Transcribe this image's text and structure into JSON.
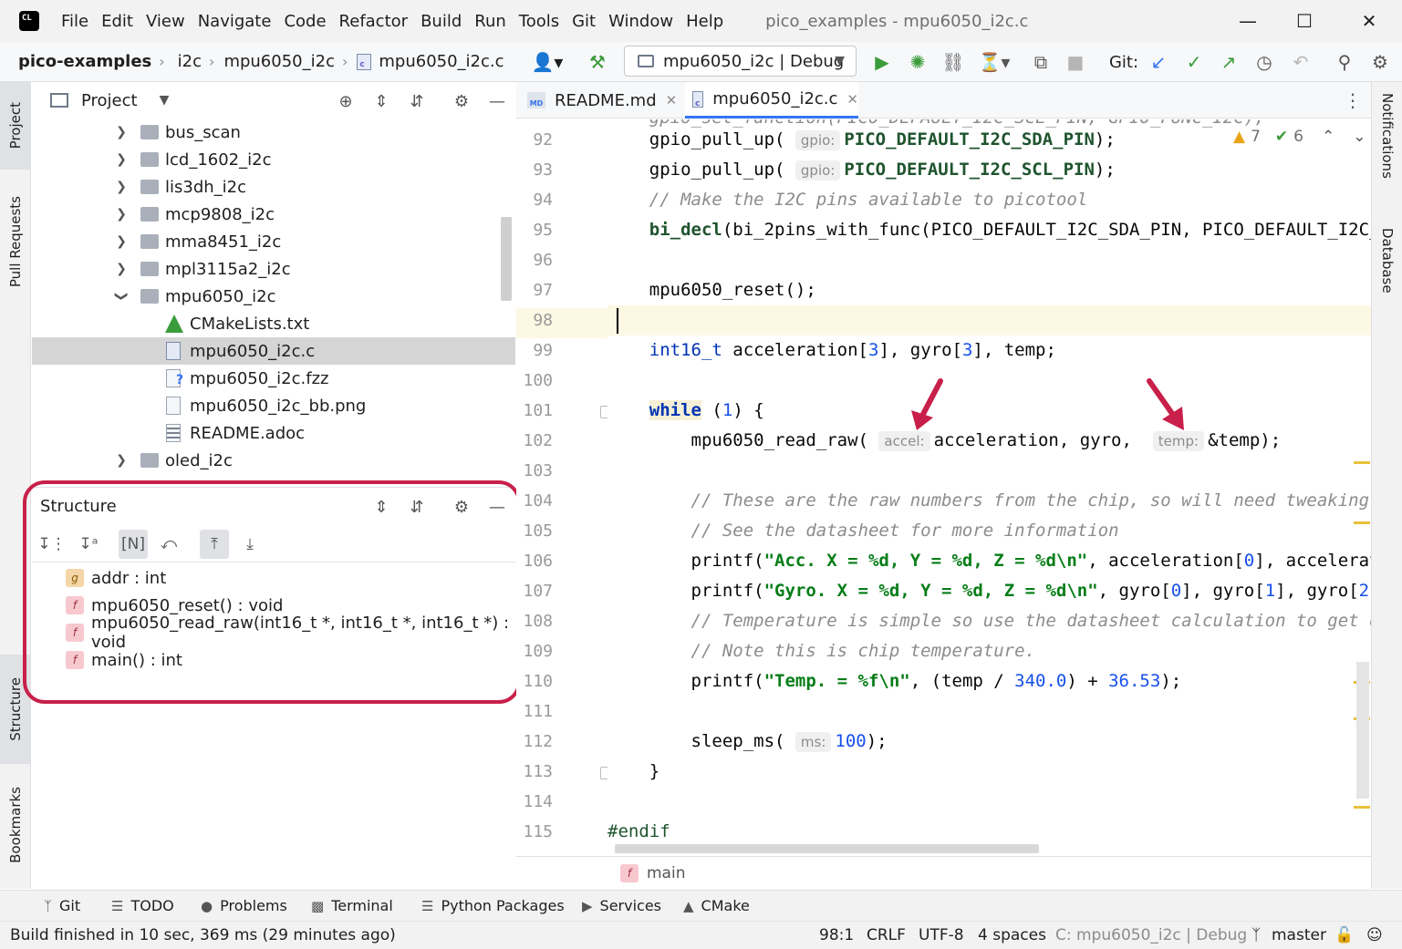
{
  "titlebar": {
    "logo_text": "CL",
    "menu": [
      "File",
      "Edit",
      "View",
      "Navigate",
      "Code",
      "Refactor",
      "Build",
      "Run",
      "Tools",
      "Git",
      "Window",
      "Help"
    ],
    "window_title": "pico_examples - mpu6050_i2c.c"
  },
  "navbar": {
    "breadcrumbs": [
      "pico-examples",
      "i2c",
      "mpu6050_i2c",
      "mpu6050_i2c.c"
    ],
    "run_config": "mpu6050_i2c | Debug",
    "git_label": "Git:"
  },
  "left_stripe": {
    "project": "Project",
    "pull_requests": "Pull Requests",
    "structure": "Structure",
    "bookmarks": "Bookmarks"
  },
  "right_stripe": {
    "notifications": "Notifications",
    "database": "Database"
  },
  "project_panel": {
    "title": "Project",
    "tree": [
      {
        "label": "bus_scan",
        "kind": "folder",
        "state": "collapsed"
      },
      {
        "label": "lcd_1602_i2c",
        "kind": "folder",
        "state": "collapsed"
      },
      {
        "label": "lis3dh_i2c",
        "kind": "folder",
        "state": "collapsed"
      },
      {
        "label": "mcp9808_i2c",
        "kind": "folder",
        "state": "collapsed"
      },
      {
        "label": "mma8451_i2c",
        "kind": "folder",
        "state": "collapsed"
      },
      {
        "label": "mpl3115a2_i2c",
        "kind": "folder",
        "state": "collapsed"
      },
      {
        "label": "mpu6050_i2c",
        "kind": "folder",
        "state": "expanded"
      },
      {
        "label": "CMakeLists.txt",
        "kind": "cmake"
      },
      {
        "label": "mpu6050_i2c.c",
        "kind": "c",
        "selected": true
      },
      {
        "label": "mpu6050_i2c.fzz",
        "kind": "unknown"
      },
      {
        "label": "mpu6050_i2c_bb.png",
        "kind": "image"
      },
      {
        "label": "README.adoc",
        "kind": "text"
      },
      {
        "label": "oled_i2c",
        "kind": "folder",
        "state": "collapsed"
      }
    ]
  },
  "structure_panel": {
    "title": "Structure",
    "members": [
      {
        "icon": "g",
        "kind": "var",
        "label": "addr : int"
      },
      {
        "icon": "f",
        "kind": "fn",
        "label": "mpu6050_reset() : void"
      },
      {
        "icon": "f",
        "kind": "fn",
        "label": "mpu6050_read_raw(int16_t *, int16_t *, int16_t *) : void"
      },
      {
        "icon": "f",
        "kind": "fn",
        "label": "main() : int"
      }
    ]
  },
  "editor": {
    "tabs": [
      {
        "label": "README.md",
        "icon": "MD",
        "active": false
      },
      {
        "label": "mpu6050_i2c.c",
        "icon": "c",
        "active": true
      }
    ],
    "inspections": {
      "warnings": "7",
      "weak_warnings": "6"
    },
    "line_numbers": [
      "92",
      "93",
      "94",
      "95",
      "96",
      "97",
      "98",
      "99",
      "100",
      "101",
      "102",
      "103",
      "104",
      "105",
      "106",
      "107",
      "108",
      "109",
      "110",
      "111",
      "112",
      "113",
      "114",
      "115"
    ],
    "hints": {
      "gpio": "gpio:",
      "accel": "accel:",
      "temp": "temp:",
      "ms": "ms:"
    },
    "footer_crumb": "main"
  },
  "tool_tabs": [
    "Git",
    "TODO",
    "Problems",
    "Terminal",
    "Python Packages",
    "Services",
    "CMake"
  ],
  "status_bar": {
    "message": "Build finished in 10 sec, 369 ms (29 minutes ago)",
    "position": "98:1",
    "line_sep": "CRLF",
    "encoding": "UTF-8",
    "indent": "4 spaces",
    "context": "C: mpu6050_i2c | Debug",
    "branch": "master"
  },
  "colors": {
    "accent": "#3574f0",
    "highlight_box": "#c8204a",
    "annotation_arrow": "#c8204a",
    "current_line": "#fdf8e4"
  }
}
